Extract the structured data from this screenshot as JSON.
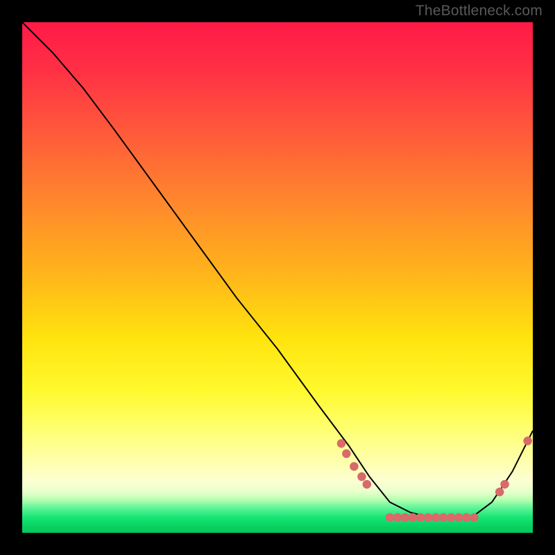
{
  "watermark": "TheBottleneck.com",
  "chart_data": {
    "type": "line",
    "title": "",
    "xlabel": "",
    "ylabel": "",
    "xlim": [
      0,
      100
    ],
    "ylim": [
      0,
      100
    ],
    "grid": false,
    "legend": false,
    "background": "rainbow-gradient (red top → yellow middle → green bottom)",
    "note": "Axes unlabeled; values are estimated percentages of plot extent. Y=100 is top (worst / red), Y≈3 is best (green band). Curve descends from upper-left into a flat minimum around x≈70–90, then rises toward the right edge.",
    "series": [
      {
        "name": "curve",
        "type": "line",
        "color": "#000000",
        "x": [
          0,
          6,
          12,
          18,
          26,
          34,
          42,
          50,
          58,
          64,
          68,
          72,
          76,
          80,
          84,
          88,
          92,
          96,
          100
        ],
        "y": [
          100,
          94,
          87,
          79,
          68,
          57,
          46,
          36,
          25,
          17,
          11,
          6,
          4,
          3,
          3,
          3,
          6,
          12,
          20
        ]
      },
      {
        "name": "markers-left-cluster",
        "type": "scatter",
        "color": "#d86a6a",
        "x": [
          62.5,
          63.5,
          65.0,
          66.5,
          67.5
        ],
        "y": [
          17.5,
          15.5,
          13.0,
          11.0,
          9.5
        ]
      },
      {
        "name": "markers-bottom-flat",
        "type": "scatter",
        "color": "#d86a6a",
        "x": [
          72,
          73.5,
          75,
          76.5,
          78,
          79.5,
          81,
          82.5,
          84,
          85.5,
          87,
          88.5
        ],
        "y": [
          3.0,
          3.0,
          3.0,
          3.0,
          3.0,
          3.0,
          3.0,
          3.0,
          3.0,
          3.0,
          3.0,
          3.0
        ]
      },
      {
        "name": "markers-right-rise",
        "type": "scatter",
        "color": "#d86a6a",
        "x": [
          93.5,
          94.5,
          99.0
        ],
        "y": [
          8.0,
          9.5,
          18.0
        ]
      }
    ]
  }
}
